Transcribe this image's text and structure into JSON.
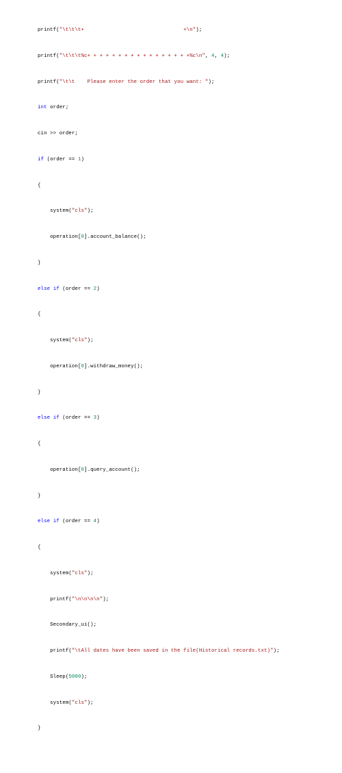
{
  "code": {
    "lines": [
      [
        {
          "t": "printf(",
          "c": ""
        },
        {
          "t": "\"\\t\\t\\t+                                +\\n\"",
          "c": "str"
        },
        {
          "t": ");",
          "c": ""
        }
      ],
      [],
      [
        {
          "t": "printf(",
          "c": ""
        },
        {
          "t": "\"\\t\\t\\t%c+ + + + + + + + + + + + + + + + +%c\\n\"",
          "c": "str"
        },
        {
          "t": ", ",
          "c": ""
        },
        {
          "t": "4",
          "c": "num"
        },
        {
          "t": ", ",
          "c": ""
        },
        {
          "t": "4",
          "c": "num"
        },
        {
          "t": ");",
          "c": ""
        }
      ],
      [],
      [
        {
          "t": "printf(",
          "c": ""
        },
        {
          "t": "\"\\t\\t    Please enter the order that you want: \"",
          "c": "str"
        },
        {
          "t": ");",
          "c": ""
        }
      ],
      [],
      [
        {
          "t": "int",
          "c": "kw"
        },
        {
          "t": " order;",
          "c": ""
        }
      ],
      [],
      [
        {
          "t": "cin >> order;",
          "c": ""
        }
      ],
      [],
      [
        {
          "t": "if",
          "c": "kw"
        },
        {
          "t": " (order == ",
          "c": ""
        },
        {
          "t": "1",
          "c": "num"
        },
        {
          "t": ")",
          "c": ""
        }
      ],
      [],
      [
        {
          "t": "{",
          "c": ""
        }
      ],
      [],
      [
        {
          "t": "    system(",
          "c": ""
        },
        {
          "t": "\"cls\"",
          "c": "str"
        },
        {
          "t": ");",
          "c": ""
        }
      ],
      [],
      [
        {
          "t": "    operation[",
          "c": ""
        },
        {
          "t": "0",
          "c": "num"
        },
        {
          "t": "].account_balance();",
          "c": ""
        }
      ],
      [],
      [
        {
          "t": "}",
          "c": ""
        }
      ],
      [],
      [
        {
          "t": "else",
          "c": "kw"
        },
        {
          "t": " ",
          "c": ""
        },
        {
          "t": "if",
          "c": "kw"
        },
        {
          "t": " (order == ",
          "c": ""
        },
        {
          "t": "2",
          "c": "num"
        },
        {
          "t": ")",
          "c": ""
        }
      ],
      [],
      [
        {
          "t": "{",
          "c": ""
        }
      ],
      [],
      [
        {
          "t": "    system(",
          "c": ""
        },
        {
          "t": "\"cls\"",
          "c": "str"
        },
        {
          "t": ");",
          "c": ""
        }
      ],
      [],
      [
        {
          "t": "    operation[",
          "c": ""
        },
        {
          "t": "0",
          "c": "num"
        },
        {
          "t": "].withdraw_money();",
          "c": ""
        }
      ],
      [],
      [
        {
          "t": "}",
          "c": ""
        }
      ],
      [],
      [
        {
          "t": "else",
          "c": "kw"
        },
        {
          "t": " ",
          "c": ""
        },
        {
          "t": "if",
          "c": "kw"
        },
        {
          "t": " (order == ",
          "c": ""
        },
        {
          "t": "3",
          "c": "num"
        },
        {
          "t": ")",
          "c": ""
        }
      ],
      [],
      [
        {
          "t": "{",
          "c": ""
        }
      ],
      [],
      [
        {
          "t": "    operation[",
          "c": ""
        },
        {
          "t": "0",
          "c": "num"
        },
        {
          "t": "].query_account();",
          "c": ""
        }
      ],
      [],
      [
        {
          "t": "}",
          "c": ""
        }
      ],
      [],
      [
        {
          "t": "else",
          "c": "kw"
        },
        {
          "t": " ",
          "c": ""
        },
        {
          "t": "if",
          "c": "kw"
        },
        {
          "t": " (order == ",
          "c": ""
        },
        {
          "t": "4",
          "c": "num"
        },
        {
          "t": ")",
          "c": ""
        }
      ],
      [],
      [
        {
          "t": "{",
          "c": ""
        }
      ],
      [],
      [
        {
          "t": "    system(",
          "c": ""
        },
        {
          "t": "\"cls\"",
          "c": "str"
        },
        {
          "t": ");",
          "c": ""
        }
      ],
      [],
      [
        {
          "t": "    printf(",
          "c": ""
        },
        {
          "t": "\"\\n\\n\\n\\n\"",
          "c": "str"
        },
        {
          "t": ");",
          "c": ""
        }
      ],
      [],
      [
        {
          "t": "    Secondary_ui();",
          "c": ""
        }
      ],
      [],
      [
        {
          "t": "    printf(",
          "c": ""
        },
        {
          "t": "\"\\tAll dates have been saved in the file(Historical records.txt)\"",
          "c": "str"
        },
        {
          "t": ");",
          "c": ""
        }
      ],
      [],
      [
        {
          "t": "    Sleep(",
          "c": ""
        },
        {
          "t": "5000",
          "c": "num"
        },
        {
          "t": ");",
          "c": ""
        }
      ],
      [],
      [
        {
          "t": "    system(",
          "c": ""
        },
        {
          "t": "\"cls\"",
          "c": "str"
        },
        {
          "t": ");",
          "c": ""
        }
      ],
      [],
      [
        {
          "t": "}",
          "c": ""
        }
      ]
    ]
  }
}
